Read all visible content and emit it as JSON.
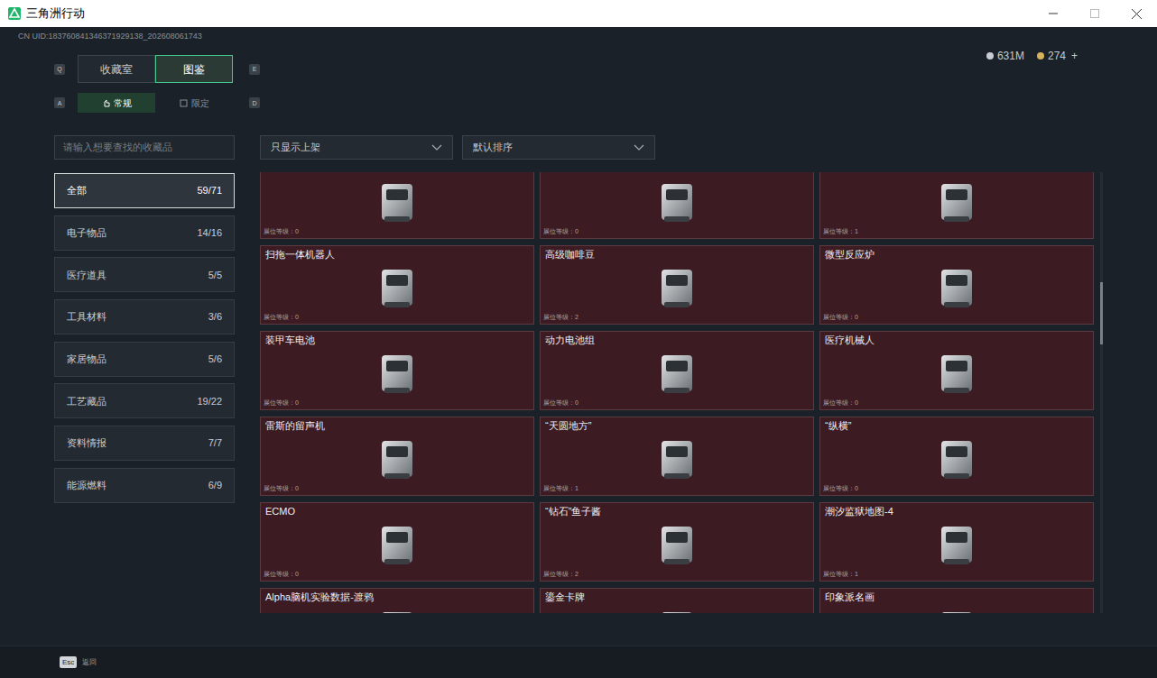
{
  "window": {
    "title": "三角洲行动"
  },
  "uid": "CN UID:183760841346371929138_202608061743",
  "currency": [
    {
      "amount": "631M",
      "color": "#c9cdd2",
      "add": ""
    },
    {
      "amount": "274",
      "color": "#d6b25a",
      "add": "+"
    }
  ],
  "tab_keys": [
    "Q",
    "E"
  ],
  "tabs": [
    {
      "label": "收藏室",
      "selected": false
    },
    {
      "label": "图鉴",
      "selected": true
    }
  ],
  "subtab_keys": [
    "A",
    "D"
  ],
  "subtabs": [
    {
      "label": "常规",
      "selected": true
    },
    {
      "label": "限定",
      "selected": false
    }
  ],
  "search": {
    "placeholder": "请输入想要查找的收藏品"
  },
  "categories": [
    {
      "name": "全部",
      "count": "59/71",
      "selected": true
    },
    {
      "name": "电子物品",
      "count": "14/16",
      "selected": false
    },
    {
      "name": "医疗道具",
      "count": "5/5",
      "selected": false
    },
    {
      "name": "工具材料",
      "count": "3/6",
      "selected": false
    },
    {
      "name": "家居物品",
      "count": "5/6",
      "selected": false
    },
    {
      "name": "工艺藏品",
      "count": "19/22",
      "selected": false
    },
    {
      "name": "资料情报",
      "count": "7/7",
      "selected": false
    },
    {
      "name": "能源燃料",
      "count": "6/9",
      "selected": false
    }
  ],
  "filters": [
    {
      "value": "只显示上架"
    },
    {
      "value": "默认排序"
    }
  ],
  "cards": [
    {
      "name": "",
      "rank": "展位等级：0"
    },
    {
      "name": "",
      "rank": "展位等级：0"
    },
    {
      "name": "",
      "rank": "展位等级：1"
    },
    {
      "name": "扫拖一体机器人",
      "rank": "展位等级：0"
    },
    {
      "name": "高级咖啡豆",
      "rank": "展位等级：2"
    },
    {
      "name": "微型反应炉",
      "rank": "展位等级：0"
    },
    {
      "name": "装甲车电池",
      "rank": "展位等级：0"
    },
    {
      "name": "动力电池组",
      "rank": "展位等级：0"
    },
    {
      "name": "医疗机械人",
      "rank": "展位等级：0"
    },
    {
      "name": "雷斯的留声机",
      "rank": "展位等级：0"
    },
    {
      "name": "“天圆地方”",
      "rank": "展位等级：1"
    },
    {
      "name": "“纵横”",
      "rank": "展位等级：0"
    },
    {
      "name": "ECMO",
      "rank": "展位等级：0"
    },
    {
      "name": "“钻石”鱼子酱",
      "rank": "展位等级：2"
    },
    {
      "name": "潮汐监狱地图-4",
      "rank": "展位等级：1"
    },
    {
      "name": "Alpha脑机实验数据-渡鸦",
      "rank": ""
    },
    {
      "name": "鎏金卡牌",
      "rank": ""
    },
    {
      "name": "印象派名画",
      "rank": ""
    }
  ],
  "scrollbar": {
    "thumb_start": 0.25,
    "thumb_size": 0.14
  },
  "footer": {
    "key": "Esc",
    "label": "返回"
  }
}
